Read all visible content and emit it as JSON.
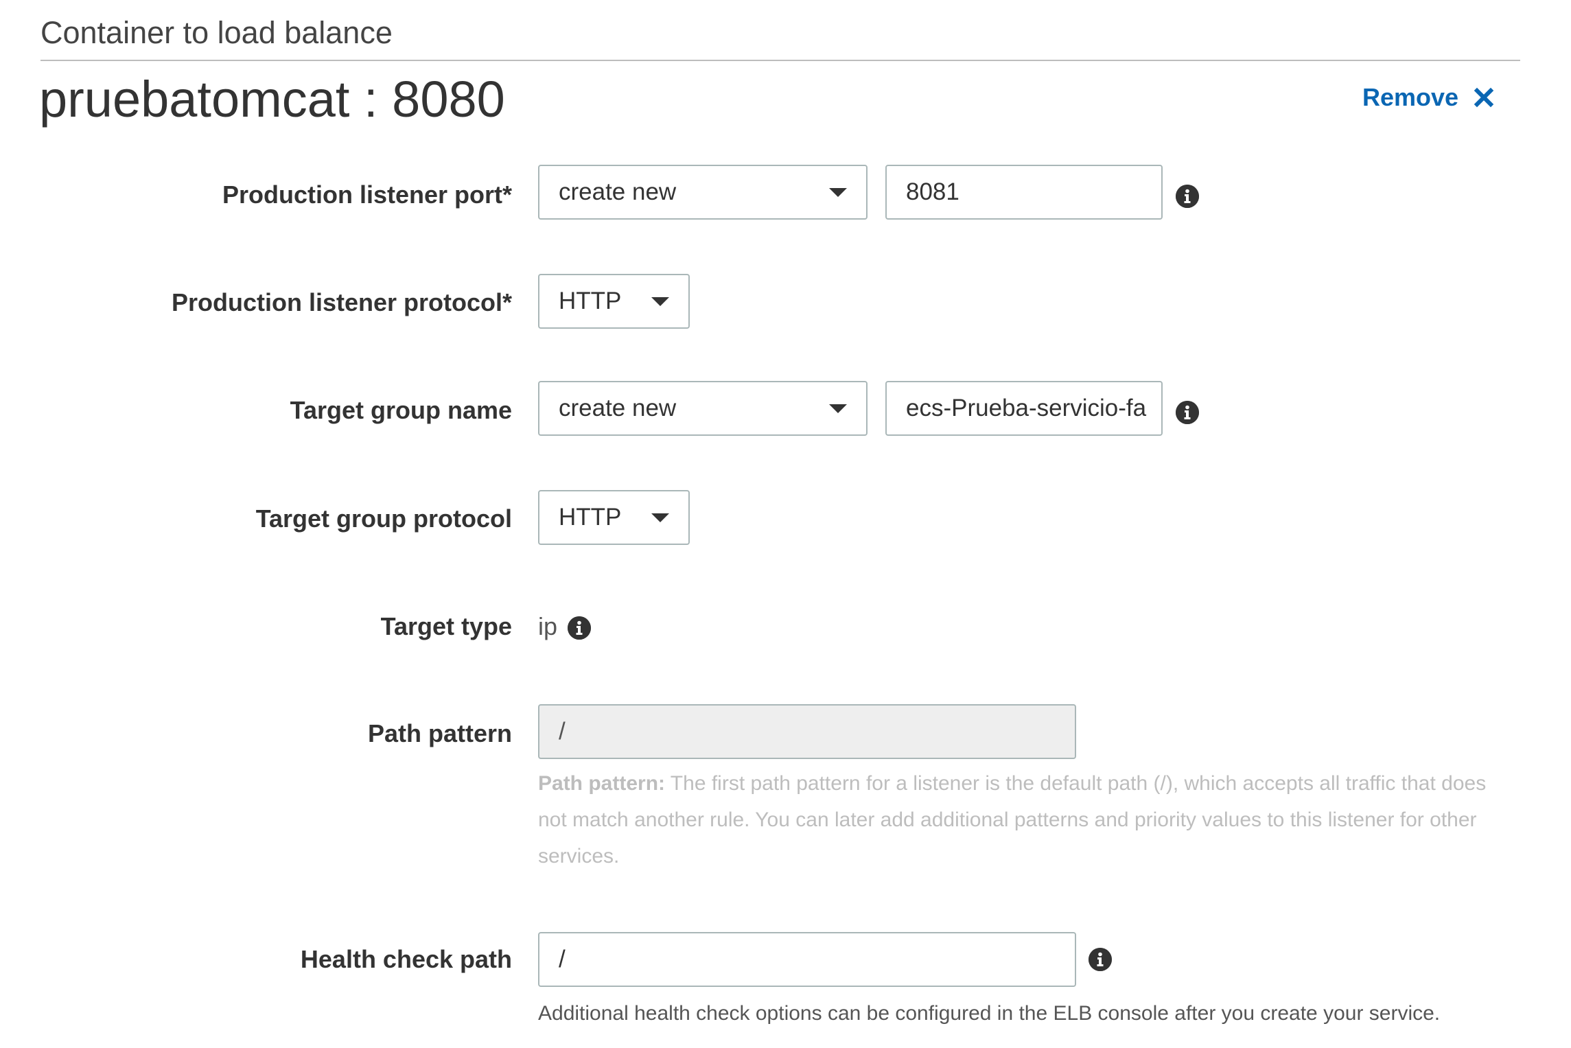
{
  "section": {
    "title": "Container to load balance"
  },
  "container": {
    "name": "pruebatomcat : 8080",
    "remove_label": "Remove"
  },
  "fields": {
    "production_listener_port": {
      "label": "Production listener port*",
      "select_value": "create new",
      "input_value": "8081"
    },
    "production_listener_protocol": {
      "label": "Production listener protocol*",
      "select_value": "HTTP"
    },
    "target_group_name": {
      "label": "Target group name",
      "select_value": "create new",
      "input_value": "ecs-Prueba-servicio-fa"
    },
    "target_group_protocol": {
      "label": "Target group protocol",
      "select_value": "HTTP"
    },
    "target_type": {
      "label": "Target type",
      "value": "ip"
    },
    "path_pattern": {
      "label": "Path pattern",
      "value": "/",
      "help_title": "Path pattern:",
      "help_text": " The first path pattern for a listener is the default path (/), which accepts all traffic that does not match another rule. You can later add additional patterns and priority values to this listener for other services."
    },
    "health_check_path": {
      "label": "Health check path",
      "value": "/",
      "note": "Additional health check options can be configured in the ELB console after you create your service."
    }
  },
  "colors": {
    "link": "#0a66b3",
    "text": "#333333",
    "border": "#aab7b8",
    "disabled_bg": "#eeeeee",
    "help_text": "#bdbdbd"
  },
  "icons": {
    "remove": "close-x-icon",
    "info": "info-circle-icon",
    "dropdown": "caret-down-icon"
  }
}
